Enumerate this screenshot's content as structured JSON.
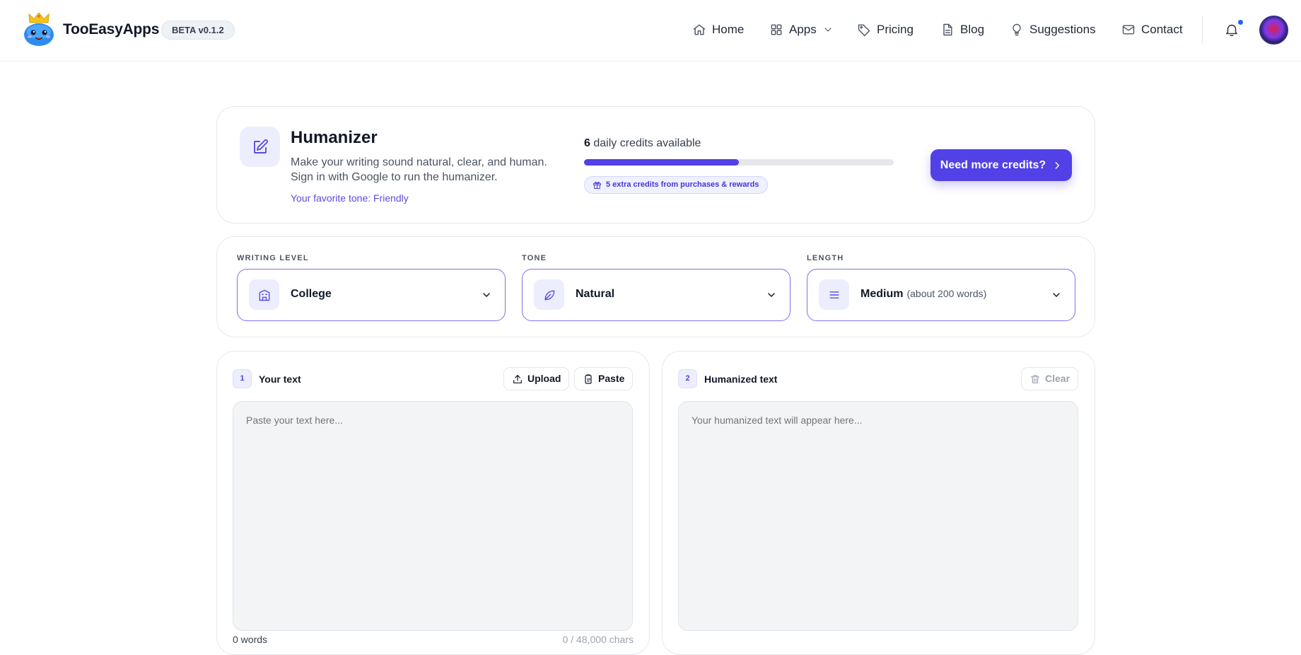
{
  "nav": {
    "brand": "TooEasyApps",
    "version": "BETA v0.1.2",
    "links": [
      {
        "label": "Home",
        "icon": "home-icon"
      },
      {
        "label": "Apps",
        "icon": "grid-icon"
      },
      {
        "label": "Pricing",
        "icon": "tag-icon"
      },
      {
        "label": "Blog",
        "icon": "document-icon"
      },
      {
        "label": "Suggestions",
        "icon": "lightbulb-icon"
      },
      {
        "label": "Contact",
        "icon": "mail-icon"
      }
    ]
  },
  "hero": {
    "title": "Humanizer",
    "description": "Make your writing sound natural, clear, and human. Sign in with Google to run the humanizer.",
    "favorite_tone": "Your favorite tone: Friendly",
    "credits_count": "6",
    "credits_text": "daily credits available",
    "credits_progress": 0.5,
    "extra_credits": "5 extra credits from purchases & rewards",
    "more_button": "Need more credits?"
  },
  "options": {
    "writing_level": {
      "label": "WRITING LEVEL",
      "value": "College"
    },
    "tone": {
      "label": "TONE",
      "value": "Natural"
    },
    "length": {
      "label": "LENGTH",
      "value": "Medium",
      "sub": "(about 200 words)"
    }
  },
  "input_panel": {
    "step": "1",
    "title": "Your text",
    "upload_label": "Upload",
    "paste_label": "Paste",
    "placeholder": "Paste your text here...",
    "word_count": "0 words",
    "char_count": "0 / 48,000 chars"
  },
  "output_panel": {
    "step": "2",
    "title": "Humanized text",
    "clear_label": "Clear",
    "placeholder": "Your humanized text will appear here..."
  },
  "colors": {
    "accent": "#5141e6",
    "notification": "#2563eb"
  }
}
